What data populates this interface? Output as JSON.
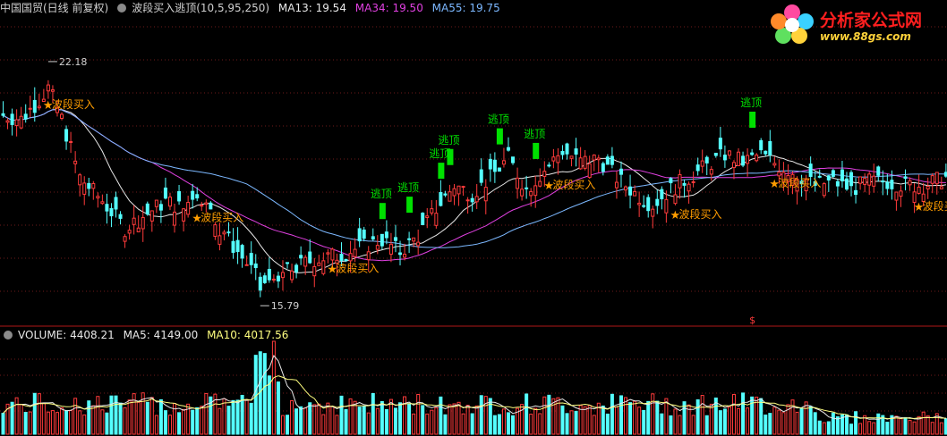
{
  "header": {
    "stock_name": "中国国贸(日线 前复权)",
    "indicator": "波段买入逃顶(10,5,95,250)",
    "ma13_label": "MA13: 19.54",
    "ma34_label": "MA34: 19.50",
    "ma55_label": "MA55: 19.75"
  },
  "volume_header": {
    "volume_label": "VOLUME: 4408.21",
    "ma5_label": "MA5: 4149.00",
    "ma10_label": "MA10: 4017.56"
  },
  "logo": {
    "text": "分析家公式网",
    "url": "www.88gs.com"
  },
  "colors": {
    "up": "#ff3b3b",
    "down": "#54ffff",
    "ma13": "#e8e8e8",
    "ma34": "#e040e0",
    "ma55": "#7cb8ff",
    "signal_top": "#00e000",
    "signal_buy": "#ff9d00",
    "grid": "#6e1a1a",
    "vol_ma5": "#e8e8e8",
    "vol_ma10": "#ffff80"
  },
  "chart_data": {
    "type": "candlestick",
    "price_range": [
      15.2,
      23.0
    ],
    "high_annotation": {
      "label": "22.18",
      "index": 10
    },
    "low_annotation": {
      "label": "15.79",
      "index": 57
    },
    "close_trend": [
      [
        0,
        20.5
      ],
      [
        4,
        20.4
      ],
      [
        8,
        20.9
      ],
      [
        10,
        21.2
      ],
      [
        13,
        20.4
      ],
      [
        17,
        18.9
      ],
      [
        22,
        18.3
      ],
      [
        27,
        17.6
      ],
      [
        31,
        17.9
      ],
      [
        36,
        18.3
      ],
      [
        40,
        18.1
      ],
      [
        43,
        18.6
      ],
      [
        46,
        17.9
      ],
      [
        50,
        17.3
      ],
      [
        54,
        16.7
      ],
      [
        57,
        16.2
      ],
      [
        61,
        16.4
      ],
      [
        65,
        16.6
      ],
      [
        69,
        16.8
      ],
      [
        74,
        16.9
      ],
      [
        79,
        17.1
      ],
      [
        84,
        17.3
      ],
      [
        88,
        17.0
      ],
      [
        92,
        17.4
      ],
      [
        96,
        18.1
      ],
      [
        100,
        18.7
      ],
      [
        104,
        18.5
      ],
      [
        108,
        18.9
      ],
      [
        112,
        19.4
      ],
      [
        116,
        18.6
      ],
      [
        120,
        19.1
      ],
      [
        124,
        19.6
      ],
      [
        128,
        19.3
      ],
      [
        132,
        19.4
      ],
      [
        136,
        18.9
      ],
      [
        140,
        18.5
      ],
      [
        144,
        18.2
      ],
      [
        148,
        18.6
      ],
      [
        152,
        18.9
      ],
      [
        156,
        19.2
      ],
      [
        160,
        19.5
      ],
      [
        164,
        19.3
      ],
      [
        168,
        19.5
      ],
      [
        172,
        19.2
      ],
      [
        176,
        19.0
      ],
      [
        180,
        18.7
      ],
      [
        184,
        18.8
      ],
      [
        188,
        18.6
      ],
      [
        192,
        18.8
      ],
      [
        196,
        18.8
      ],
      [
        200,
        18.7
      ],
      [
        204,
        18.7
      ],
      [
        209,
        18.9
      ]
    ],
    "signals": [
      {
        "label": "波段买入",
        "index": 10,
        "type": "buy"
      },
      {
        "label": "波段买入",
        "index": 43,
        "type": "buy"
      },
      {
        "label": "波段买入",
        "index": 73,
        "type": "buy"
      },
      {
        "label": "波段买入",
        "index": 121,
        "type": "buy"
      },
      {
        "label": "波段买入",
        "index": 149,
        "type": "buy"
      },
      {
        "label": "波段买入",
        "index": 171,
        "type": "buy"
      },
      {
        "label": "波段买入",
        "index": 203,
        "type": "buy"
      },
      {
        "label": "逃顶",
        "index": 84,
        "type": "top"
      },
      {
        "label": "逃顶",
        "index": 90,
        "type": "top"
      },
      {
        "label": "逃顶",
        "index": 97,
        "type": "top"
      },
      {
        "label": "逃顶",
        "index": 99,
        "type": "top"
      },
      {
        "label": "逃顶",
        "index": 110,
        "type": "top"
      },
      {
        "label": "逃顶",
        "index": 118,
        "type": "top"
      },
      {
        "label": "逃顶",
        "index": 166,
        "type": "top"
      }
    ],
    "dollar_marker": {
      "label": "$",
      "index": 166
    }
  }
}
